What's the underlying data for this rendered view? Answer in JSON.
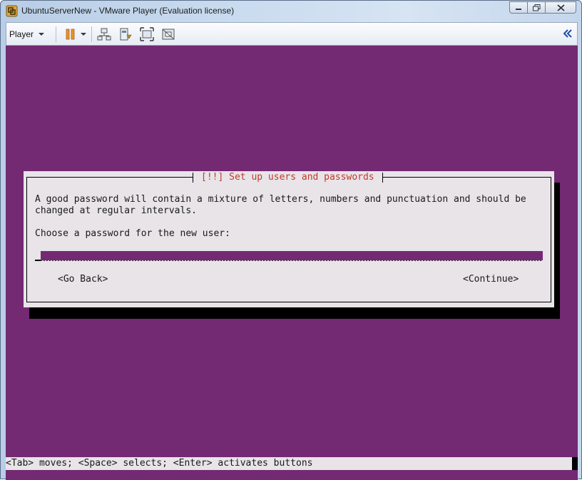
{
  "window": {
    "title": "UbuntuServerNew - VMware Player (Evaluation license)",
    "app_icon": "vmware-player-icon",
    "caption_buttons": [
      "minimize-icon",
      "restore-icon",
      "close-icon"
    ]
  },
  "toolbar": {
    "player_menu_label": "Player",
    "icons": [
      "pause-icon",
      "dropdown-arrow-icon",
      "network-icon",
      "removable-devices-icon",
      "fullscreen-icon",
      "unity-icon",
      "collapse-toolbar-icon"
    ]
  },
  "installer": {
    "dialog_title": "[!!] Set up users and passwords",
    "line1": "A good password will contain a mixture of letters, numbers and punctuation and should be",
    "line2": "changed at regular intervals.",
    "prompt": "Choose a password for the new user:",
    "password_value": "",
    "go_back_label": "<Go Back>",
    "continue_label": "<Continue>"
  },
  "status_bar": {
    "text": "<Tab> moves; <Space> selects; <Enter> activates buttons"
  },
  "colors": {
    "console_background": "#732a73",
    "dialog_background": "#e8e4e8",
    "dialog_title": "#c23a2e",
    "pause_orange": "#e8952b"
  }
}
